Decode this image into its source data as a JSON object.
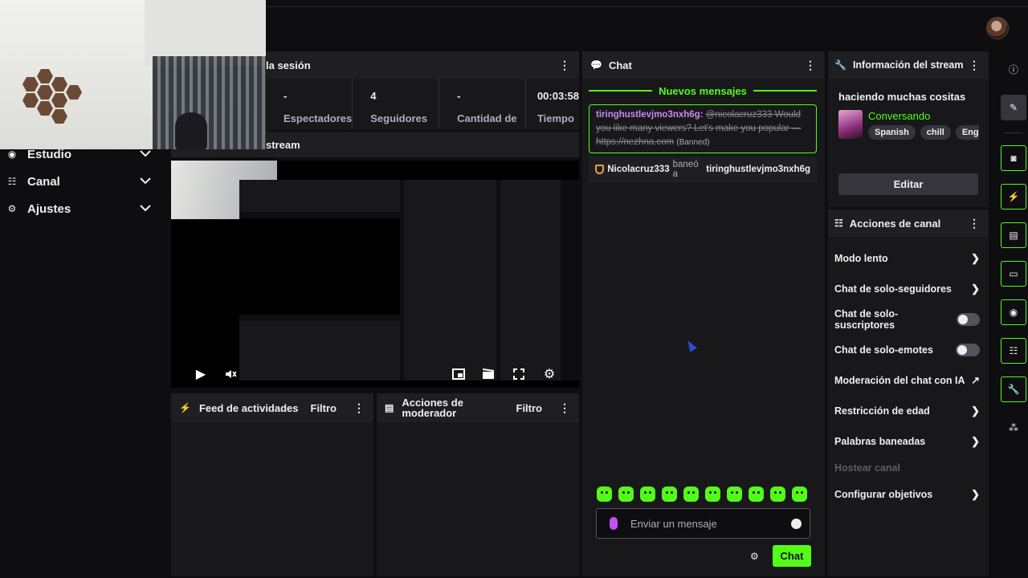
{
  "session": {
    "title": "la sesión",
    "stats": [
      {
        "value": "-",
        "label": "Espectadores"
      },
      {
        "value": "4",
        "label": "Seguidores"
      },
      {
        "value": "-",
        "label": "Cantidad de"
      },
      {
        "value": "00:03:58",
        "label": "Tiempo"
      }
    ]
  },
  "stream_preview": {
    "title": "stream"
  },
  "sidebar": {
    "items": [
      {
        "label": "Estudio"
      },
      {
        "label": "Canal"
      },
      {
        "label": "Ajustes"
      }
    ]
  },
  "feed": {
    "title": "Feed de actividades",
    "filter": "Filtro"
  },
  "moderator": {
    "title": "Acciones de moderador",
    "filter": "Filtro"
  },
  "chat": {
    "title": "Chat",
    "new_messages": "Nuevos mensajes",
    "message": {
      "user": "tiringhustlevjmo3nxh6g:",
      "text": "@nicolacruz333 Would you like many viewers? Let's make you popular — https://nezhna.com",
      "banned": "(Banned)"
    },
    "ban": {
      "moderator": "Nicolacruz333",
      "action": "baneó a",
      "target": "tiringhustlevjmo3nxh6g"
    },
    "input_placeholder": "Enviar un mensaje",
    "send_label": "Chat"
  },
  "stream_info": {
    "title": "Información del stream",
    "stream_title": "haciendo muchas cositas",
    "category": "Conversando",
    "tags": [
      "Spanish",
      "chill",
      "English"
    ],
    "edit_label": "Editar"
  },
  "channel_actions": {
    "title": "Acciones de canal",
    "items": [
      {
        "label": "Modo lento"
      },
      {
        "label": "Chat de solo-seguidores"
      },
      {
        "label": "Chat de solo-suscriptores"
      },
      {
        "label": "Chat de solo-emotes"
      },
      {
        "label": "Moderación del chat con IA"
      },
      {
        "label": "Restricción de edad"
      },
      {
        "label": "Palabras baneadas"
      },
      {
        "label": "Hostear canal"
      },
      {
        "label": "Configurar objetivos"
      }
    ]
  },
  "colors": {
    "accent": "#53fc18",
    "background": "#0e0e10",
    "panel": "#18181b"
  }
}
